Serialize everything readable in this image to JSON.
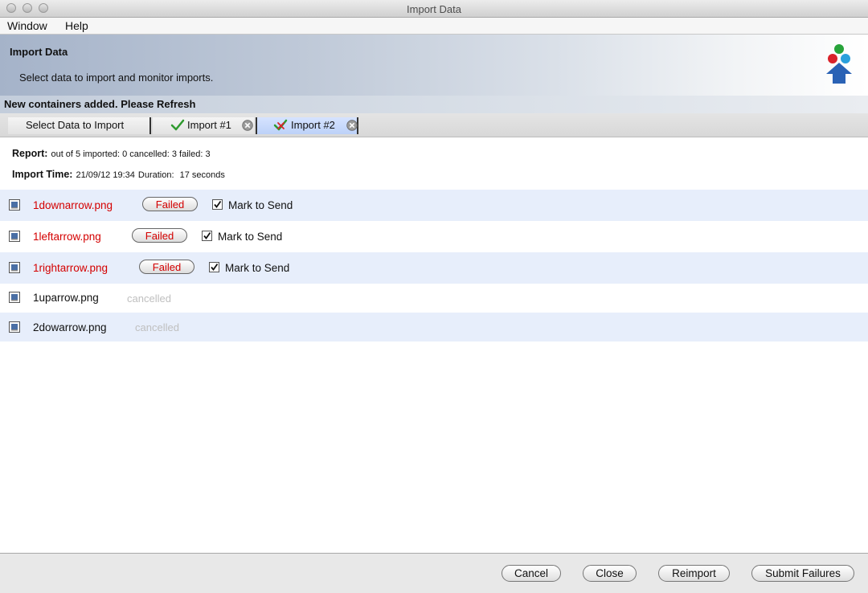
{
  "window": {
    "title": "Import Data"
  },
  "menu": [
    "Window",
    "Help"
  ],
  "banner": {
    "title": "Import Data",
    "subtitle": "Select data to import and monitor imports."
  },
  "notice": "New containers added. Please Refresh",
  "tabs": [
    {
      "label": "Select Data to Import"
    },
    {
      "label": "Import #1",
      "icon": "green-check-icon"
    },
    {
      "label": "Import #2",
      "icon": "check-cross-icon",
      "selected": true
    }
  ],
  "report": {
    "label": "Report:",
    "text": "out of 5 imported: 0 cancelled: 3 failed: 3",
    "time_label": "Import Time:",
    "time_value": "21/09/12 19:34",
    "duration_label": "Duration:",
    "duration_value": "17 seconds"
  },
  "files": [
    {
      "name": "1downarrow.png",
      "status": "Failed",
      "mark_label": "Mark to Send",
      "marked": true
    },
    {
      "name": "1leftarrow.png",
      "status": "Failed",
      "mark_label": "Mark to Send",
      "marked": true
    },
    {
      "name": "1rightarrow.png",
      "status": "Failed",
      "mark_label": "Mark to Send",
      "marked": true
    },
    {
      "name": "1uparrow.png",
      "status": "cancelled"
    },
    {
      "name": "2dowarrow.png",
      "status": "cancelled"
    }
  ],
  "buttons": {
    "cancel": "Cancel",
    "close": "Close",
    "reimport": "Reimport",
    "submit": "Submit Failures"
  },
  "colors": {
    "failed": "#d40000",
    "selected_tab": "#c4d6fa",
    "row_alt": "#e7eefb"
  }
}
